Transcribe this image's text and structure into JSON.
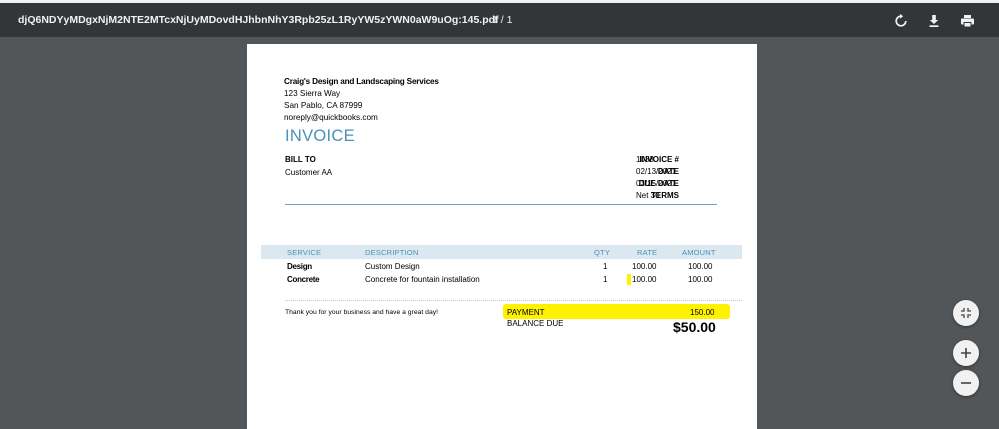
{
  "toolbar": {
    "filename": "djQ6NDYyMDgxNjM2NTE2MTcxNjUyMDovdHJhbnNhY3Rpb25zL1RyYW5zYWN0aW9uOg:145.pdf",
    "page_count": "1 / 1"
  },
  "invoice": {
    "company": {
      "name": "Craig's Design and Landscaping Services",
      "street": "123 Sierra Way",
      "city": "San Pablo, CA  87999",
      "email": "noreply@quickbooks.com"
    },
    "title": "INVOICE",
    "bill_to_label": "BILL TO",
    "customer": "Customer AA",
    "meta": [
      {
        "label": "INVOICE #",
        "value": "1038"
      },
      {
        "label": "DATE",
        "value": "02/13/2021"
      },
      {
        "label": "DUE DATE",
        "value": "03/15/2021"
      },
      {
        "label": "TERMS",
        "value": "Net 30"
      }
    ],
    "columns": {
      "service": "SERVICE",
      "description": "DESCRIPTION",
      "qty": "QTY",
      "rate": "RATE",
      "amount": "AMOUNT"
    },
    "lines": [
      {
        "service": "Design",
        "description": "Custom Design",
        "qty": "1",
        "rate": "100.00",
        "amount": "100.00"
      },
      {
        "service": "Concrete",
        "description": "Concrete for fountain installation",
        "qty": "1",
        "rate": "100.00",
        "amount": "100.00"
      }
    ],
    "thanks": "Thank you for your business and have a great day!",
    "payment_label": "PAYMENT",
    "payment_value": "150.00",
    "balance_label": "BALANCE DUE",
    "balance_value": "$50.00"
  },
  "highlight_color": "#fff200",
  "icons": [
    "rotate-icon",
    "download-icon",
    "print-icon",
    "fit-page-icon",
    "zoom-in-icon",
    "zoom-out-icon"
  ]
}
